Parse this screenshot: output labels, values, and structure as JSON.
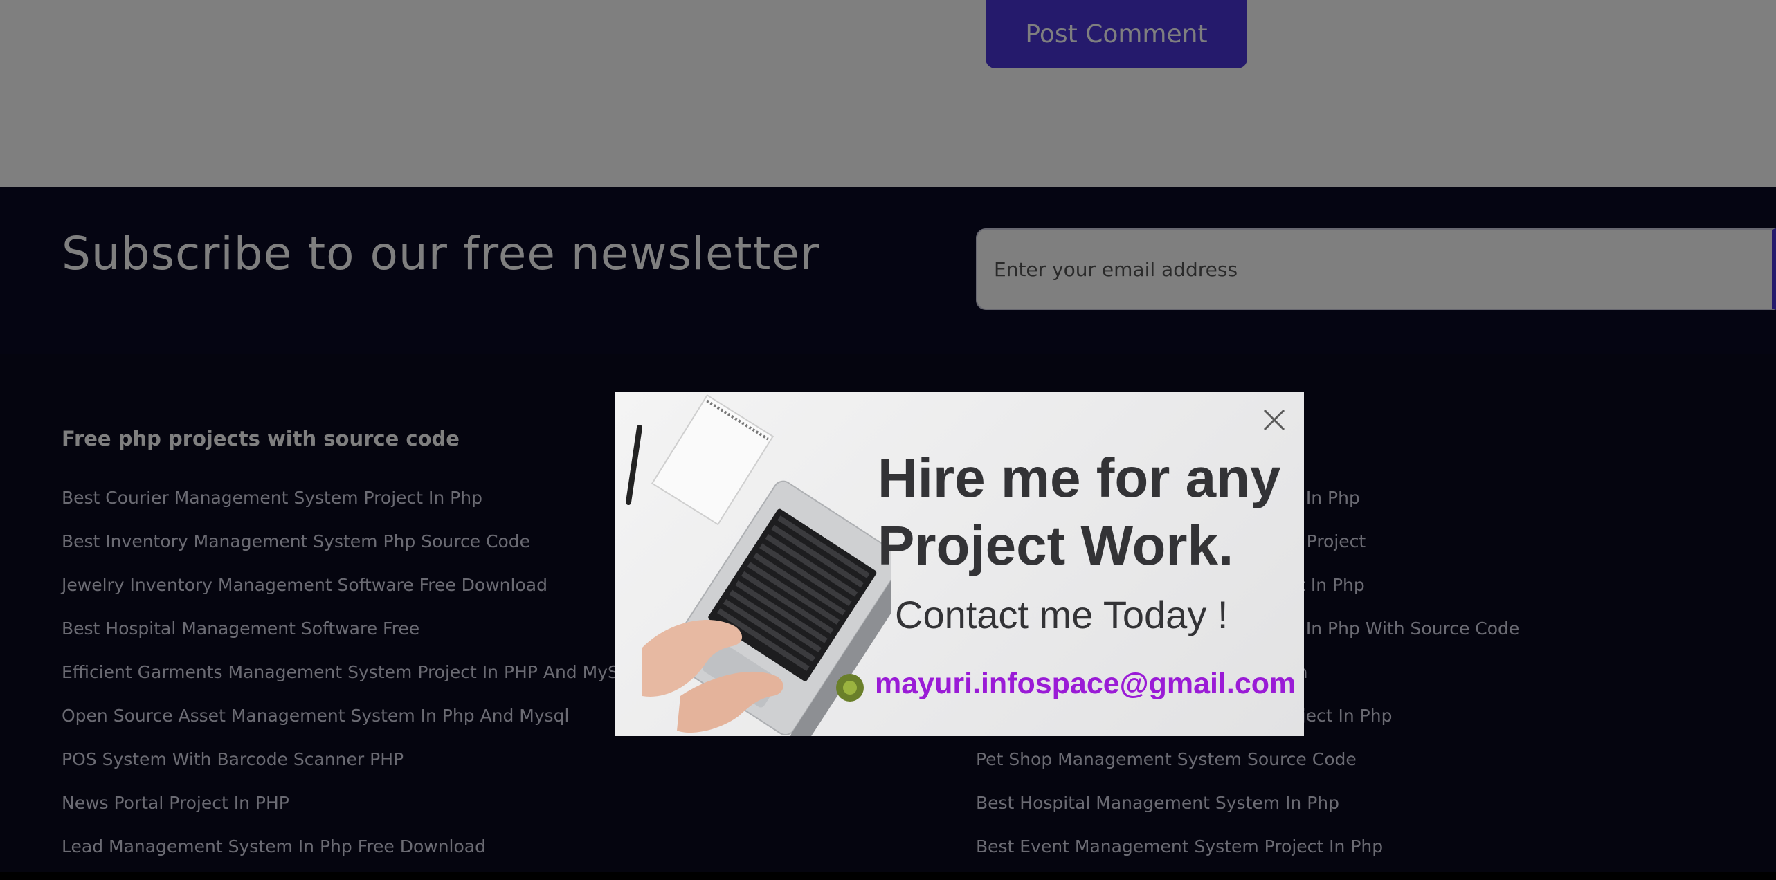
{
  "comment_form": {
    "post_button": "Post Comment"
  },
  "newsletter": {
    "title": "Subscribe to our free newsletter",
    "email_placeholder": "Enter your email address"
  },
  "footer": {
    "left_heading": "Free php projects with source code",
    "left_links": [
      "Best Courier Management System Project In Php",
      "Best Inventory Management System Php Source Code",
      "Jewelry Inventory Management Software Free Download",
      "Best Hospital Management Software Free",
      "Efficient Garments Management System Project In PHP And MySQL",
      "Open Source Asset Management System In Php And Mysql",
      "POS System With Barcode Scanner PHP",
      "News Portal Project In PHP",
      "Lead Management System In Php Free Download"
    ],
    "right_links": [
      "ect In Php",
      "em Project",
      "ject In Php",
      "ect In Php With Source Code",
      "tem",
      "Project In Php",
      "Pet Shop Management System Source Code",
      "Best Hospital Management System In Php",
      "Best Event Management System Project In Php"
    ]
  },
  "popup": {
    "headline": "Hire me for any Project Work.",
    "subheadline": "Contact me Today !",
    "email": "mayuri.infospace@gmail.com",
    "close_icon": "close-icon"
  },
  "colors": {
    "accent": "#4a35d9",
    "footer_bg": "#0b0b1f",
    "newsletter_bg": "#0a0a24",
    "email_text": "#9a1bd6",
    "headline_text": "#333336"
  }
}
